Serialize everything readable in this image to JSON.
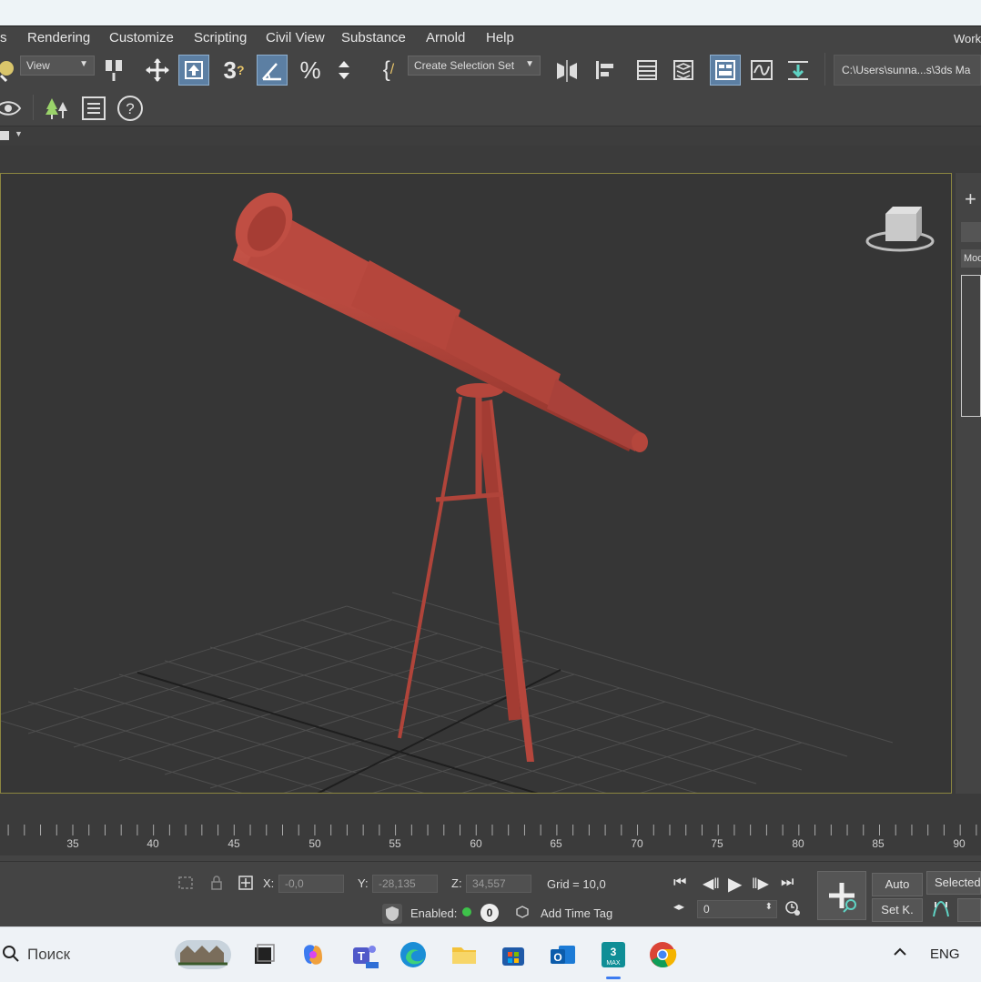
{
  "window": {
    "workspace_label": "Work"
  },
  "menu": {
    "items": [
      "s",
      "Rendering",
      "Customize",
      "Scripting",
      "Civil View",
      "Substance",
      "Arnold",
      "Help"
    ]
  },
  "toolbar": {
    "view_dropdown": "View",
    "selection_set": "Create Selection Set",
    "path": "C:\\Users\\sunna...s\\3ds Ma"
  },
  "right_panel": {
    "tab_label": "Mod"
  },
  "timeline": {
    "ticks": [
      "35",
      "40",
      "45",
      "50",
      "55",
      "60",
      "65",
      "70",
      "75",
      "80",
      "85",
      "90"
    ]
  },
  "status": {
    "x_label": "X:",
    "x_value": "-0,0",
    "y_label": "Y:",
    "y_value": "-28,135",
    "z_label": "Z:",
    "z_value": "34,557",
    "grid": "Grid = 10,0",
    "enabled_label": "Enabled:",
    "enabled_count": "0",
    "add_time_tag": "Add Time Tag",
    "frame_value": "0",
    "auto_label": "Auto",
    "setk_label": "Set K.",
    "selected_label": "Selected"
  },
  "taskbar": {
    "search_placeholder": "Поиск",
    "language": "ENG"
  },
  "colors": {
    "model": "#b5463c",
    "viewport_border": "#8c8640",
    "active_button": "#5c7fa3"
  }
}
